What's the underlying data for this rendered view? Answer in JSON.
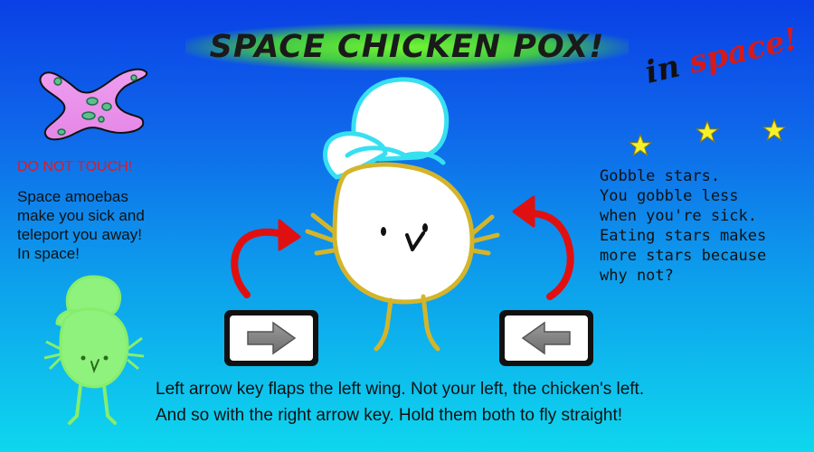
{
  "title": "SPACE CHICKEN POX!",
  "subtitle": {
    "word1": "in",
    "word2": "space!"
  },
  "amoeba": {
    "warning": "DO NOT TOUCH!",
    "description_lines": [
      "Space amoebas",
      "make you sick and",
      "teleport you away!",
      "In space!"
    ]
  },
  "stars": {
    "description_lines": [
      "Gobble stars.",
      "You gobble less",
      "when you're sick.",
      "Eating stars makes",
      "more stars because",
      "why not?"
    ]
  },
  "instructions": {
    "line1": "Left arrow key flaps the left wing. Not your left, the chicken's left.",
    "line2": "And so with the right arrow key. Hold them both to fly straight!"
  },
  "keys": {
    "left_key_icon": "right-arrow-icon",
    "right_key_icon": "left-arrow-icon"
  },
  "colors": {
    "title_glow": "#6be82a",
    "warning": "#e8161b",
    "flap_arrow": "#e01010",
    "star": "#f5f02a",
    "chicken_outline": "#d4b52a",
    "chef_hat_outline": "#37e0f0",
    "sick_chicken": "#8ef27c",
    "amoeba": "#e59ae6"
  }
}
